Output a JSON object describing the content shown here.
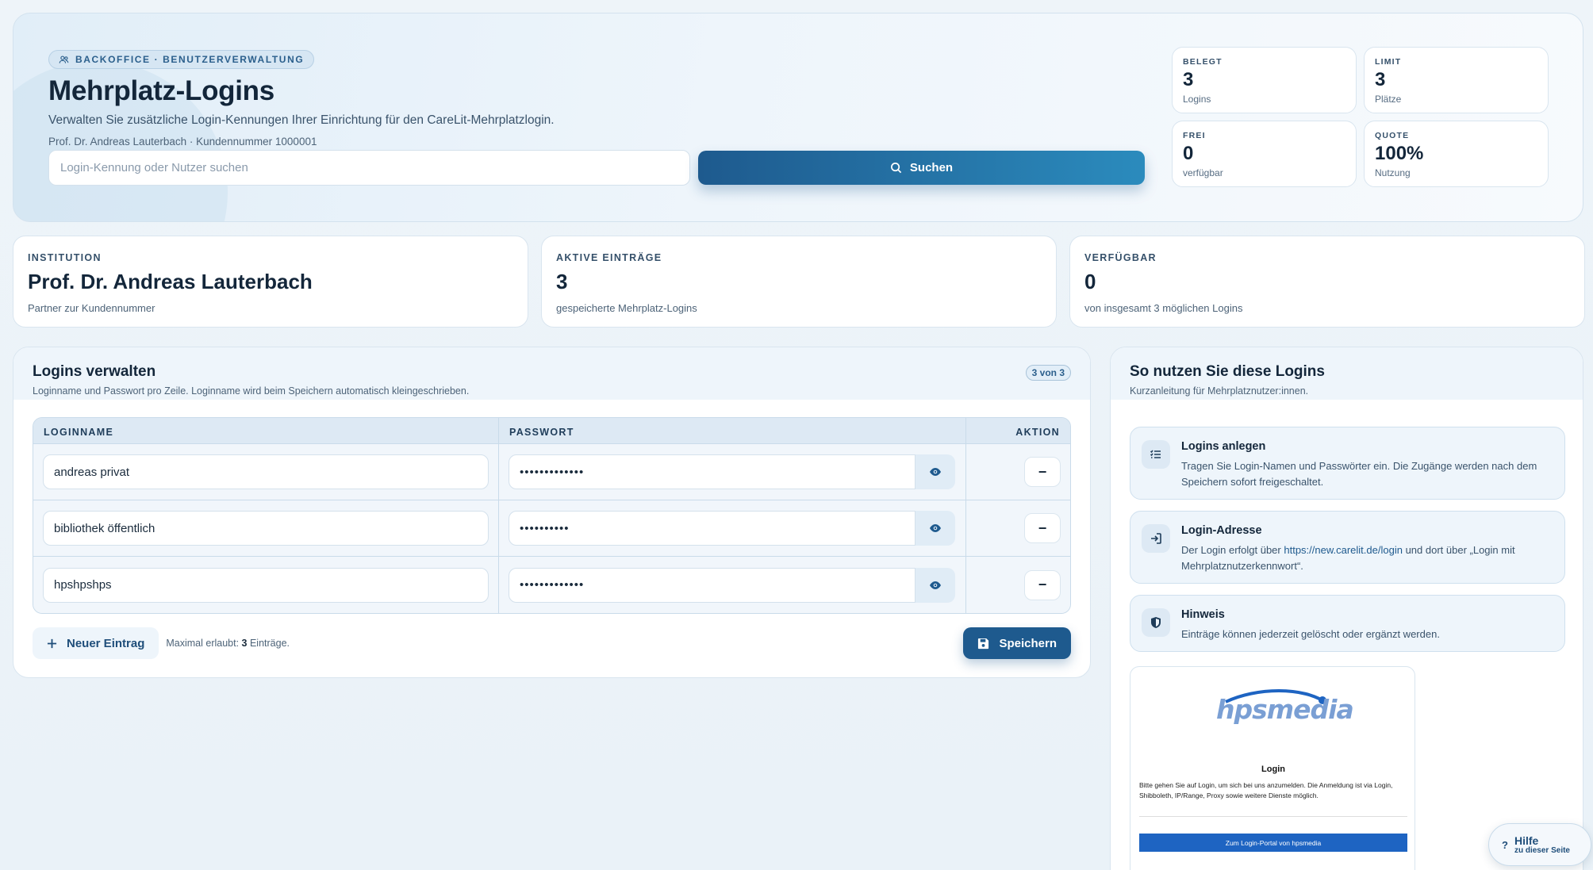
{
  "hero": {
    "badge": "BACKOFFICE · BENUTZERVERWALTUNG",
    "title": "Mehrplatz-Logins",
    "subtitle": "Verwalten Sie zusätzliche Login-Kennungen Ihrer Einrichtung für den CareLit-Mehrplatzlogin.",
    "meta": "Prof. Dr. Andreas Lauterbach · Kundennummer 1000001",
    "search_placeholder": "Login-Kennung oder Nutzer suchen",
    "search_button": "Suchen"
  },
  "stats": [
    {
      "label": "BELEGT",
      "value": "3",
      "unit": "Logins"
    },
    {
      "label": "LIMIT",
      "value": "3",
      "unit": "Plätze"
    },
    {
      "label": "FREI",
      "value": "0",
      "unit": "verfügbar"
    },
    {
      "label": "QUOTE",
      "value": "100%",
      "unit": "Nutzung"
    }
  ],
  "summary": [
    {
      "label": "INSTITUTION",
      "value": "Prof. Dr. Andreas Lauterbach",
      "desc": "Partner zur Kundennummer"
    },
    {
      "label": "AKTIVE EINTRÄGE",
      "value": "3",
      "desc": "gespeicherte Mehrplatz-Logins"
    },
    {
      "label": "VERFÜGBAR",
      "value": "0",
      "desc": "von insgesamt 3 möglichen Logins"
    }
  ],
  "manage": {
    "title": "Logins verwalten",
    "hint": "Loginname und Passwort pro Zeile. Loginname wird beim Speichern automatisch kleingeschrieben.",
    "count": "3 von 3",
    "columns": {
      "name": "LOGINNAME",
      "password": "PASSWORT",
      "action": "AKTION"
    },
    "rows": [
      {
        "name": "andreas privat",
        "password": "passwort12345"
      },
      {
        "name": "bibliothek öffentlich",
        "password": "passwort12"
      },
      {
        "name": "hpshpshps",
        "password": "passwort12345"
      }
    ],
    "remove_label": "−",
    "new_button": "Neuer Eintrag",
    "max_prefix": "Maximal erlaubt: ",
    "max_value": "3",
    "max_suffix": " Einträge.",
    "save_button": "Speichern"
  },
  "guide": {
    "title": "So nutzen Sie diese Logins",
    "hint": "Kurzanleitung für Mehrplatznutzer:innen.",
    "tips": [
      {
        "title": "Logins anlegen",
        "text": "Tragen Sie Login-Namen und Passwörter ein. Die Zugänge werden nach dem Speichern sofort freigeschaltet.",
        "icon": "list-icon"
      },
      {
        "title": "Login-Adresse",
        "text_before": "Der Login erfolgt über ",
        "link": "https://new.carelit.de/login",
        "text_after": " und dort über „Login mit Mehrplatznutzerkennwort“.",
        "icon": "login-icon"
      },
      {
        "title": "Hinweis",
        "text": "Einträge können jederzeit gelöscht oder ergänzt werden.",
        "icon": "shield-icon"
      }
    ],
    "preview": {
      "logo": "hpsmedia",
      "title": "Login",
      "text": "Bitte gehen Sie auf Login, um sich bei uns anzumelden. Die Anmeldung ist via Login, Shibboleth, IP/Range, Proxy sowie weitere Dienste möglich.",
      "button": "Zum Login-Portal von hpsmedia"
    }
  },
  "help": {
    "q": "?",
    "title": "Hilfe",
    "sub": "zu dieser Seite"
  },
  "colors": {
    "accent": "#1e5a8e",
    "accent_light": "#2b8bbd",
    "ink": "#13263a"
  }
}
